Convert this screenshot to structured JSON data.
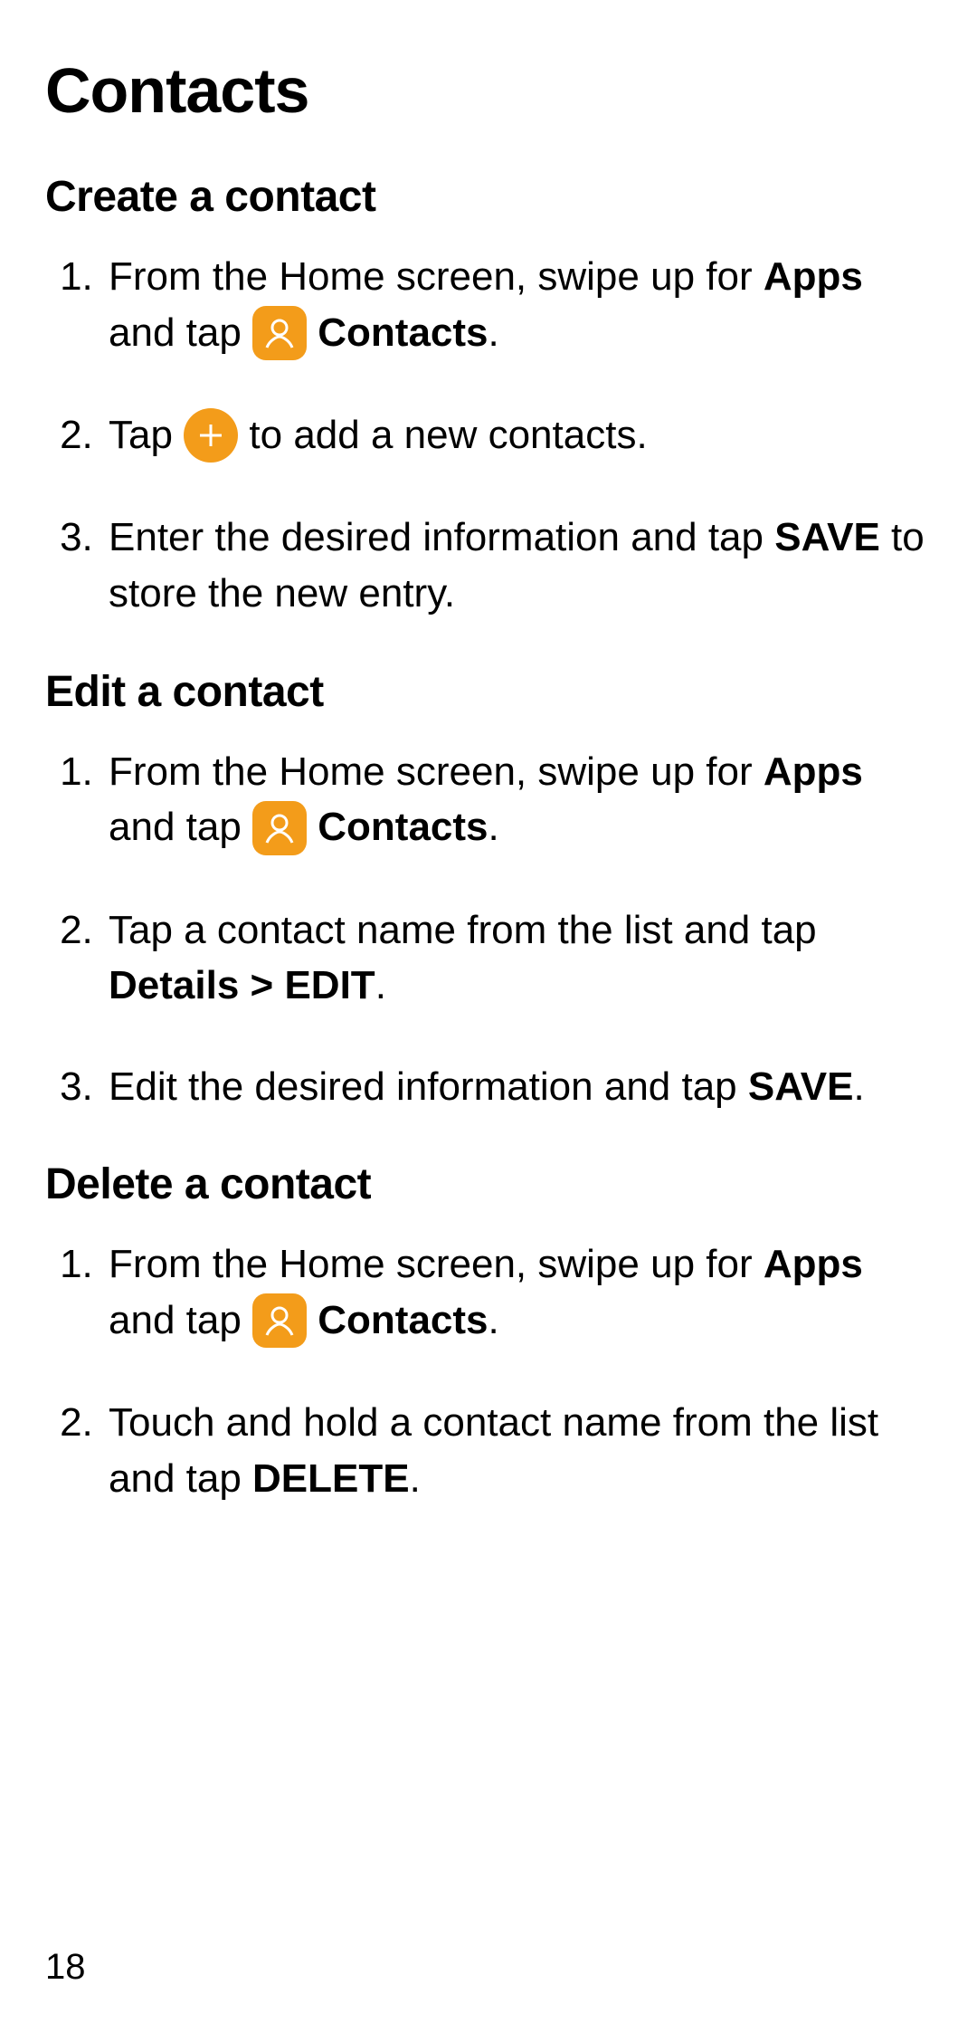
{
  "title": "Contacts",
  "page_number": "18",
  "sections": {
    "create": {
      "heading": "Create a contact",
      "step1_a": "From the Home screen, swipe up for ",
      "step1_apps": "Apps",
      "step1_b": " and tap ",
      "step1_contacts": "Contacts",
      "step1_c": ".",
      "step2_a": "Tap ",
      "step2_b": " to add a new contacts.",
      "step3_a": "Enter the desired information and tap ",
      "step3_save": "SAVE",
      "step3_b": " to store the new entry."
    },
    "edit": {
      "heading": "Edit a contact",
      "step1_a": "From the Home screen, swipe up for ",
      "step1_apps": "Apps",
      "step1_b": " and tap ",
      "step1_contacts": "Contacts",
      "step1_c": ".",
      "step2_a": "Tap a contact name from the list and tap ",
      "step2_details": "Details",
      "step2_sep": " > ",
      "step2_edit": "EDIT",
      "step2_b": ".",
      "step3_a": "Edit the desired information and tap ",
      "step3_save": "SAVE",
      "step3_b": "."
    },
    "delete": {
      "heading": "Delete a contact",
      "step1_a": "From the Home screen, swipe up for ",
      "step1_apps": "Apps",
      "step1_b": " and tap ",
      "step1_contacts": "Contacts",
      "step1_c": ".",
      "step2_a": "Touch and hold a contact name from the list and tap ",
      "step2_delete": "DELETE",
      "step2_b": "."
    }
  }
}
